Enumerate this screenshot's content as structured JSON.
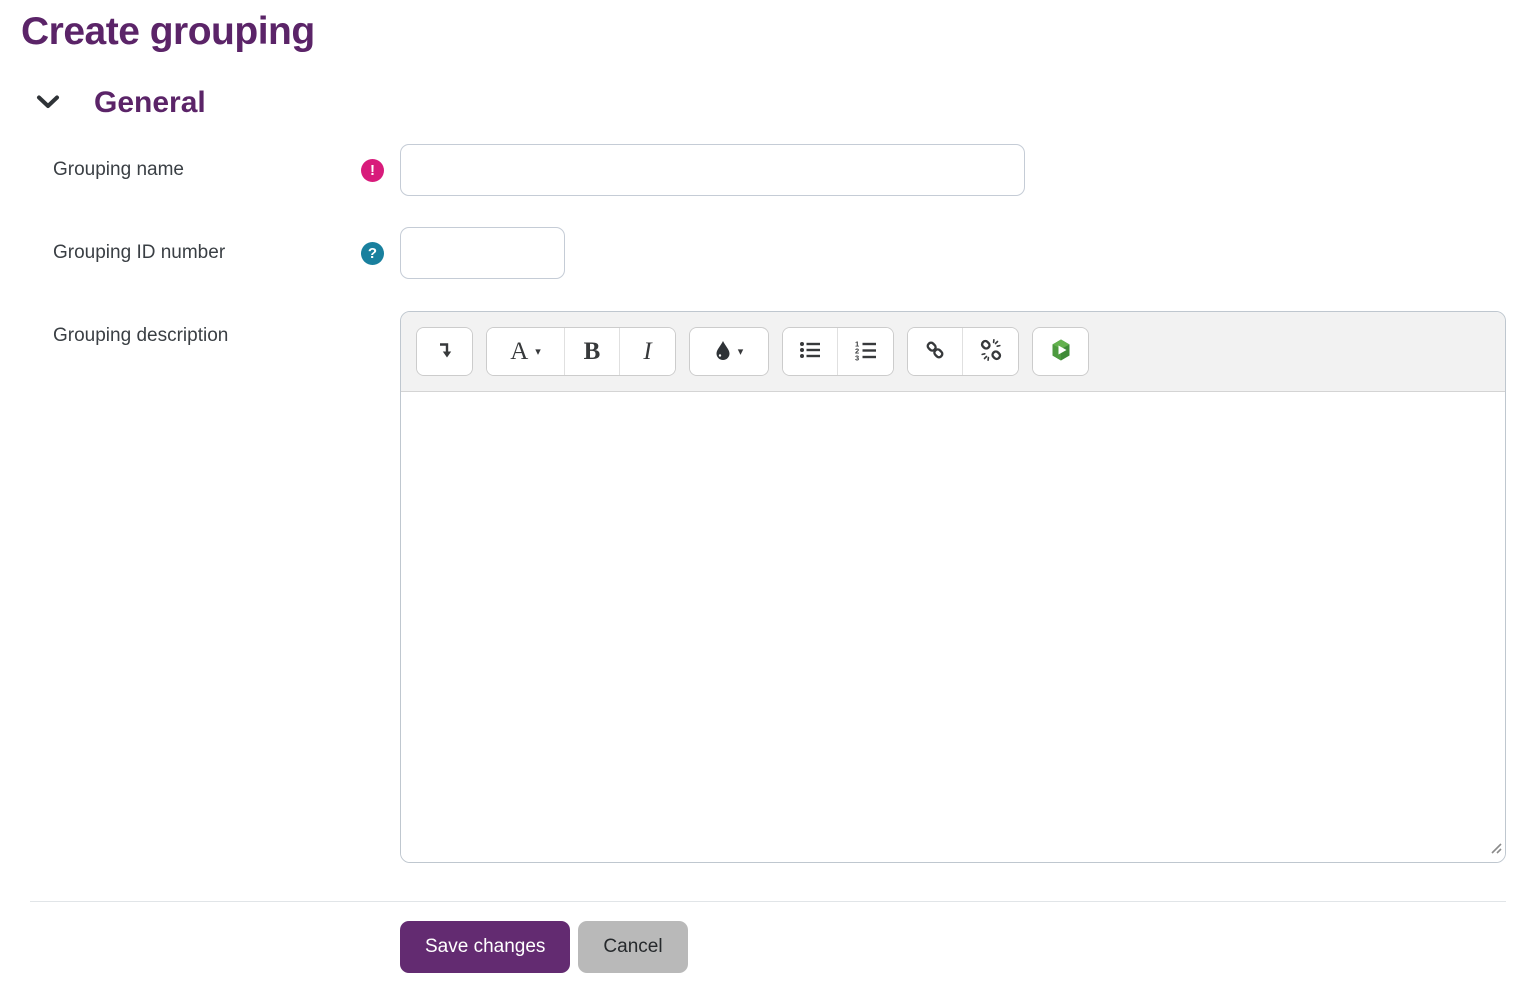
{
  "page": {
    "title": "Create grouping"
  },
  "section": {
    "title": "General",
    "collapse_icon": "chevron-down",
    "expanded": true
  },
  "form": {
    "grouping_name": {
      "label": "Grouping name",
      "value": "",
      "required": true,
      "status_icon": "required-exclamation-circle"
    },
    "grouping_id": {
      "label": "Grouping ID number",
      "value": "",
      "help_icon": "help-question-circle"
    },
    "grouping_description": {
      "label": "Grouping description",
      "value": ""
    }
  },
  "editor": {
    "toolbar_buttons": [
      "expand-toolbar-icon",
      "font-styles-icon",
      "bold-icon",
      "italic-icon",
      "font-color-droplet-icon",
      "unordered-list-icon",
      "ordered-list-icon",
      "link-icon",
      "unlink-icon",
      "insert-media-icon"
    ],
    "glyphs": {
      "font_styles": "A",
      "bold": "B",
      "italic": "I",
      "caret": "▾",
      "required_mark": "!",
      "help_mark": "?"
    }
  },
  "actions": {
    "save": "Save changes",
    "cancel": "Cancel"
  },
  "colors": {
    "heading_purple": "#5b2468",
    "primary_button_purple": "#632b71",
    "required_pink": "#d81b7b",
    "help_teal": "#19809e",
    "cancel_gray": "#b9b9b9",
    "toolbar_gray": "#f2f2f2",
    "media_green": "#4b9e3f"
  }
}
